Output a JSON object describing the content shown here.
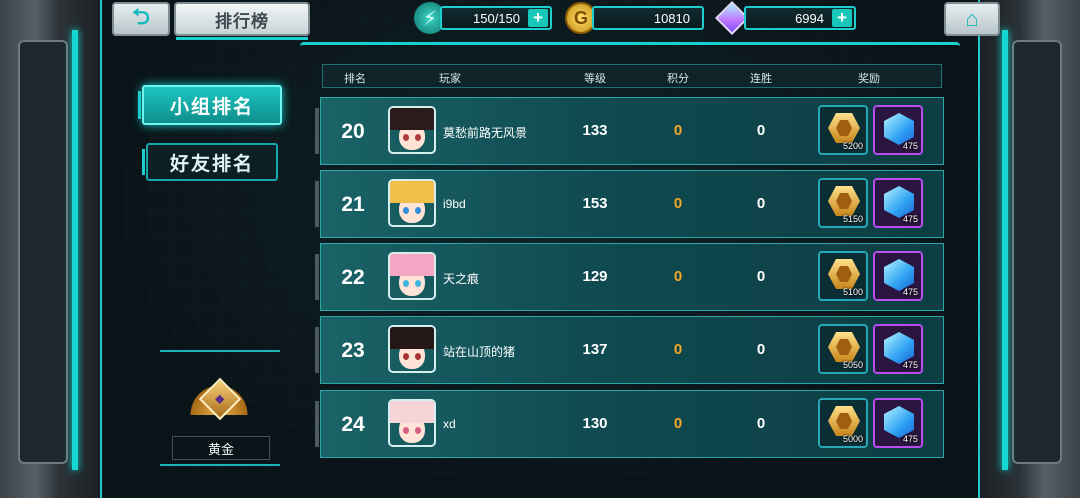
{
  "header": {
    "title": "排行榜",
    "resources": {
      "energy": "150/150",
      "gold": "10810",
      "gems": "6994"
    }
  },
  "sidebar": {
    "tabs": [
      {
        "label": "小组排名",
        "active": true
      },
      {
        "label": "好友排名",
        "active": false
      }
    ],
    "rank_tier": "黄金"
  },
  "table": {
    "columns": [
      "排名",
      "玩家",
      "等级",
      "积分",
      "连胜",
      "奖励"
    ],
    "rows": [
      {
        "rank": "20",
        "name": "莫愁前路无风景",
        "level": "133",
        "points": "0",
        "streak": "0",
        "gold_reward": "5200",
        "gem_reward": "475",
        "avatar_hair": "#2a1c1a",
        "avatar_eye": "#b03a3a"
      },
      {
        "rank": "21",
        "name": "i9bd",
        "level": "153",
        "points": "0",
        "streak": "0",
        "gold_reward": "5150",
        "gem_reward": "475",
        "avatar_hair": "#f0c04a",
        "avatar_eye": "#2f8fd8"
      },
      {
        "rank": "22",
        "name": "天之痕",
        "level": "129",
        "points": "0",
        "streak": "0",
        "gold_reward": "5100",
        "gem_reward": "475",
        "avatar_hair": "#f5a6c4",
        "avatar_eye": "#3fb4e0"
      },
      {
        "rank": "23",
        "name": "站在山顶的猪",
        "level": "137",
        "points": "0",
        "streak": "0",
        "gold_reward": "5050",
        "gem_reward": "475",
        "avatar_hair": "#231816",
        "avatar_eye": "#a83535"
      },
      {
        "rank": "24",
        "name": "xd",
        "level": "130",
        "points": "0",
        "streak": "0",
        "gold_reward": "5000",
        "gem_reward": "475",
        "avatar_hair": "#f7d4d8",
        "avatar_eye": "#d85f82"
      }
    ]
  },
  "colors": {
    "accent": "#1ccfcf",
    "points": "#f3a825",
    "gem_border": "#b84df0"
  },
  "icons": {
    "back": "back-arrow-icon",
    "home": "home-icon",
    "energy": "energy-bolt-icon",
    "gold": "gold-coin-icon",
    "gem": "gem-icon"
  }
}
